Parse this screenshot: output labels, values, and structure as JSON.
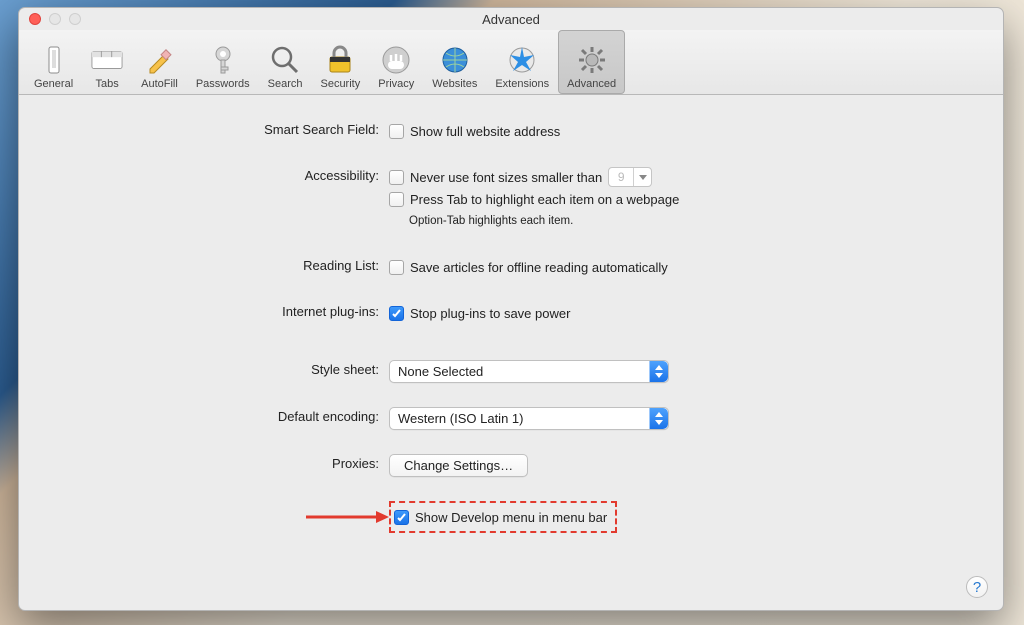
{
  "window": {
    "title": "Advanced"
  },
  "toolbar": {
    "items": [
      {
        "label": "General"
      },
      {
        "label": "Tabs"
      },
      {
        "label": "AutoFill"
      },
      {
        "label": "Passwords"
      },
      {
        "label": "Search"
      },
      {
        "label": "Security"
      },
      {
        "label": "Privacy"
      },
      {
        "label": "Websites"
      },
      {
        "label": "Extensions"
      },
      {
        "label": "Advanced"
      }
    ]
  },
  "labels": {
    "smart_search": "Smart Search Field:",
    "accessibility": "Accessibility:",
    "reading_list": "Reading List:",
    "plugins": "Internet plug-ins:",
    "style_sheet": "Style sheet:",
    "default_encoding": "Default encoding:",
    "proxies": "Proxies:"
  },
  "options": {
    "full_address": "Show full website address",
    "min_font": "Never use font sizes smaller than",
    "min_font_value": "9",
    "press_tab": "Press Tab to highlight each item on a webpage",
    "option_tab_note": "Option-Tab highlights each item.",
    "offline_reading": "Save articles for offline reading automatically",
    "stop_plugins": "Stop plug-ins to save power",
    "style_sheet_value": "None Selected",
    "encoding_value": "Western (ISO Latin 1)",
    "change_settings": "Change Settings…",
    "develop_menu": "Show Develop menu in menu bar"
  },
  "help": "?"
}
